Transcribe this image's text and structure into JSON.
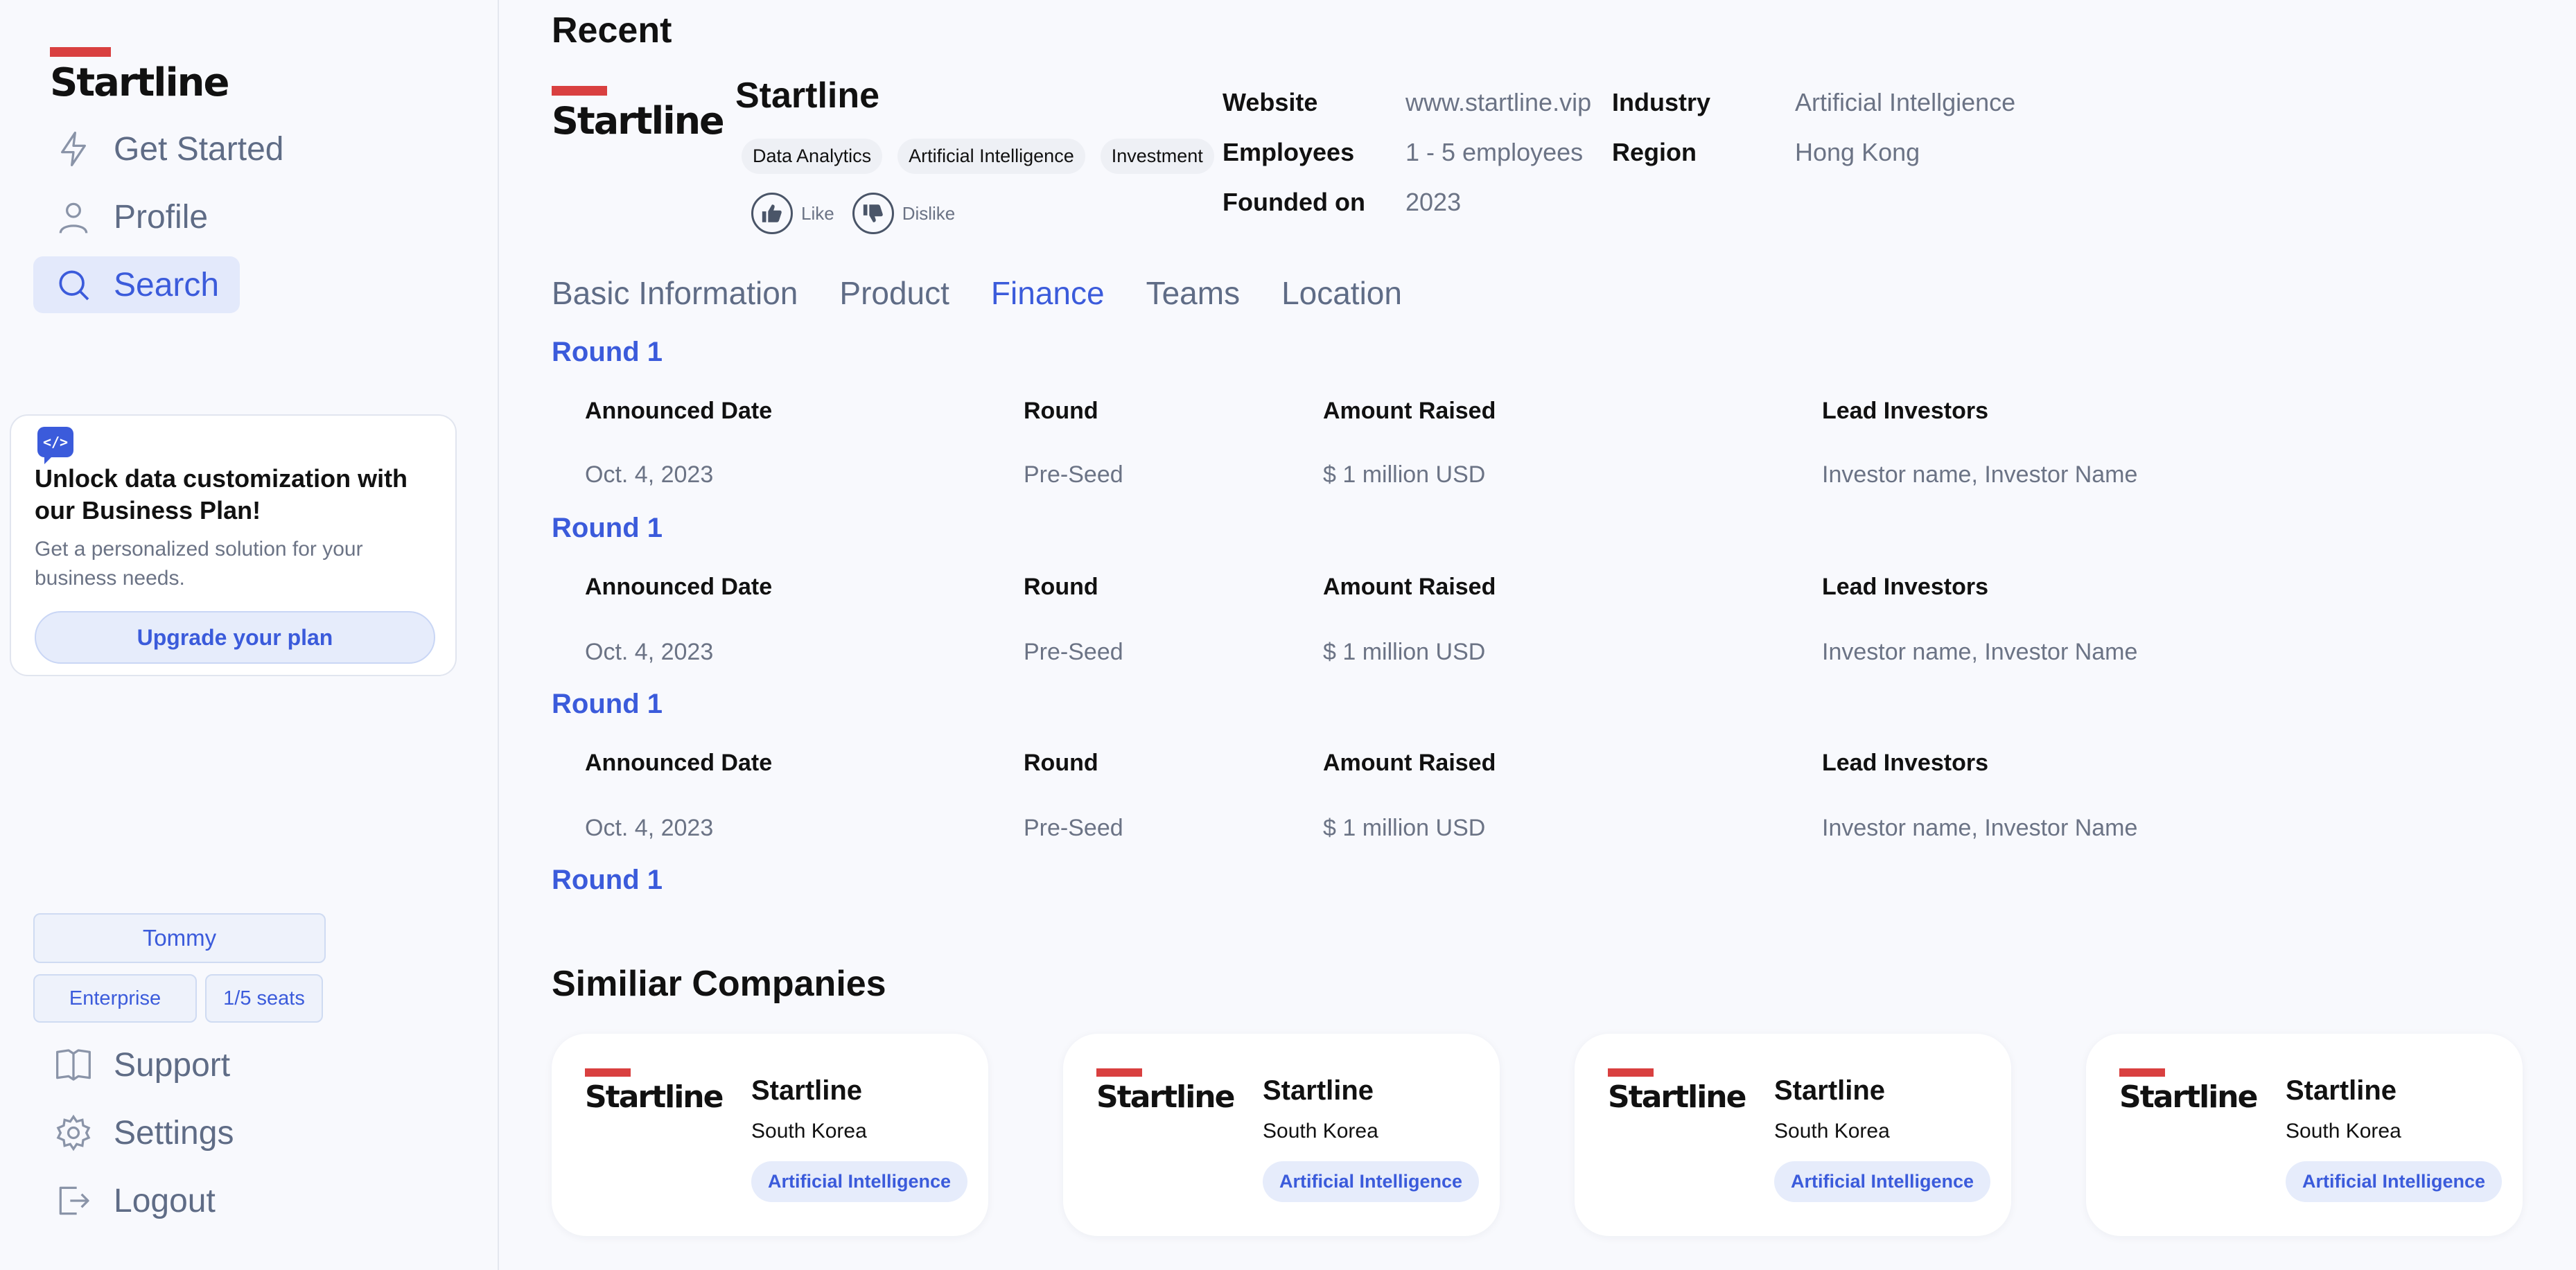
{
  "brand": {
    "logo_text": "Startline",
    "accent": "#d94040",
    "primary": "#3b5bdb"
  },
  "sidebar": {
    "nav": [
      {
        "label": "Get Started",
        "icon": "lightning-icon"
      },
      {
        "label": "Profile",
        "icon": "user-icon"
      },
      {
        "label": "Search",
        "icon": "search-icon",
        "active": true
      }
    ],
    "promo": {
      "icon": "code-icon",
      "title": "Unlock data customization with our Business Plan!",
      "text": "Get a personalized solution for your business needs.",
      "button": "Upgrade your plan"
    },
    "user": {
      "name": "Tommy",
      "plan": "Enterprise",
      "seats": "1/5 seats"
    },
    "bottom_nav": [
      {
        "label": "Support",
        "icon": "book-icon"
      },
      {
        "label": "Settings",
        "icon": "gear-icon"
      },
      {
        "label": "Logout",
        "icon": "logout-icon"
      }
    ]
  },
  "recent": {
    "heading": "Recent",
    "company": {
      "name": "Startline",
      "tags": [
        "Data Analytics",
        "Artificial Intelligence",
        "Investment"
      ],
      "like_label": "Like",
      "dislike_label": "Dislike"
    },
    "meta_left": [
      {
        "key": "Website",
        "value": "www.startline.vip"
      },
      {
        "key": "Employees",
        "value": "1 - 5 employees"
      },
      {
        "key": "Founded on",
        "value": "2023"
      }
    ],
    "meta_right": [
      {
        "key": "Industry",
        "value": "Artificial Intellgience"
      },
      {
        "key": "Region",
        "value": "Hong Kong"
      }
    ]
  },
  "tabs": [
    {
      "label": "Basic Information"
    },
    {
      "label": "Product"
    },
    {
      "label": "Finance",
      "active": true
    },
    {
      "label": "Teams"
    },
    {
      "label": "Location"
    }
  ],
  "finance": {
    "columns": [
      "Announced Date",
      "Round",
      "Amount Raised",
      "Lead Investors"
    ],
    "rounds": [
      {
        "title": "Round 1",
        "row": [
          "Oct. 4, 2023",
          "Pre-Seed",
          "$ 1 million USD",
          "Investor name, Investor Name"
        ]
      },
      {
        "title": "Round 1",
        "row": [
          "Oct. 4, 2023",
          "Pre-Seed",
          "$ 1 million USD",
          "Investor name, Investor Name"
        ]
      },
      {
        "title": "Round 1",
        "row": [
          "Oct. 4, 2023",
          "Pre-Seed",
          "$ 1 million USD",
          "Investor name, Investor Name"
        ]
      },
      {
        "title": "Round 1"
      }
    ]
  },
  "similar": {
    "heading": "Similiar Companies",
    "cards": [
      {
        "name": "Startline",
        "country": "South Korea",
        "tag": "Artificial Intelligence"
      },
      {
        "name": "Startline",
        "country": "South Korea",
        "tag": "Artificial Intelligence"
      },
      {
        "name": "Startline",
        "country": "South Korea",
        "tag": "Artificial Intelligence"
      },
      {
        "name": "Startline",
        "country": "South Korea",
        "tag": "Artificial Intelligence"
      }
    ]
  }
}
